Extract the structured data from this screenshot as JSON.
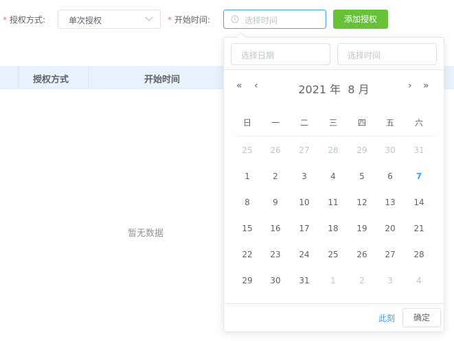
{
  "form": {
    "auth_label": "授权方式:",
    "auth_required": "*",
    "auth_value": "单次授权",
    "start_label": "开始时间:",
    "start_required": "*",
    "start_placeholder": "选择时间",
    "add_button": "添加授权"
  },
  "table": {
    "columns": [
      "授权方式",
      "开始时间"
    ],
    "empty_text": "暂无数据"
  },
  "picker": {
    "date_placeholder": "选择日期",
    "time_placeholder": "选择时间",
    "header": "2021 年  8 月",
    "prev_year": "«",
    "prev_month": "‹",
    "next_month": "›",
    "next_year": "»",
    "weekdays": [
      "日",
      "一",
      "二",
      "三",
      "四",
      "五",
      "六"
    ],
    "weeks": [
      [
        "25",
        "26",
        "27",
        "28",
        "29",
        "30",
        "31"
      ],
      [
        "1",
        "2",
        "3",
        "4",
        "5",
        "6",
        "7"
      ],
      [
        "8",
        "9",
        "10",
        "11",
        "12",
        "13",
        "14"
      ],
      [
        "15",
        "16",
        "17",
        "18",
        "19",
        "20",
        "21"
      ],
      [
        "22",
        "23",
        "24",
        "25",
        "26",
        "27",
        "28"
      ],
      [
        "29",
        "30",
        "31",
        "1",
        "2",
        "3",
        "4"
      ]
    ],
    "today": "7",
    "now_link": "此刻",
    "confirm_button": "确定"
  },
  "colors": {
    "accent": "#409eff",
    "success": "#67c23a",
    "required": "#f56c6c",
    "table_header_bg": "#e8f2fd"
  },
  "icons": {
    "select_arrow": "chevron-down-icon",
    "time_input": "clock-icon"
  }
}
